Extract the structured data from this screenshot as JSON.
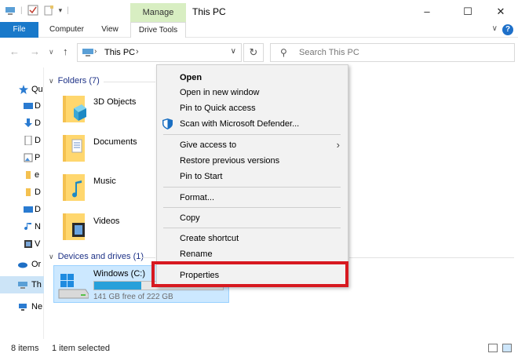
{
  "window": {
    "title": "This PC",
    "manage_tab": "Manage",
    "minimize": "–",
    "maximize": "☐",
    "close": "✕"
  },
  "ribbon": {
    "tabs": [
      "File",
      "Computer",
      "View",
      "Drive Tools"
    ],
    "help": "?"
  },
  "address": {
    "crumb": "This PC",
    "separator": "›",
    "search_placeholder": "Search This PC"
  },
  "navpane": {
    "items": [
      {
        "label": "Qu",
        "icon": "star-icon"
      },
      {
        "label": "D",
        "icon": "desktop-icon"
      },
      {
        "label": "D",
        "icon": "downloads-icon"
      },
      {
        "label": "D",
        "icon": "document-icon"
      },
      {
        "label": "P",
        "icon": "pictures-icon"
      },
      {
        "label": "e",
        "icon": "folder-icon"
      },
      {
        "label": "D",
        "icon": "folder-icon"
      },
      {
        "label": "D",
        "icon": "desktop-icon"
      },
      {
        "label": "N",
        "icon": "music-icon"
      },
      {
        "label": "V",
        "icon": "video-icon"
      },
      {
        "label": "Or",
        "icon": "onedrive-icon"
      },
      {
        "label": "Th",
        "icon": "pc-icon"
      },
      {
        "label": "Ne",
        "icon": "network-icon"
      }
    ]
  },
  "content": {
    "folders_header": "Folders (7)",
    "folders": [
      "3D Objects",
      "Documents",
      "Music",
      "Videos"
    ],
    "drives_header": "Devices and drives (1)",
    "drive": {
      "name": "Windows (C:)",
      "free_text": "141 GB free of 222 GB",
      "used_fraction": 0.365
    }
  },
  "context_menu": {
    "items": [
      {
        "label": "Open",
        "bold": true
      },
      {
        "label": "Open in new window"
      },
      {
        "label": "Pin to Quick access"
      },
      {
        "label": "Scan with Microsoft Defender...",
        "icon": "shield-icon"
      },
      {
        "label": "Give access to",
        "submenu": true
      },
      {
        "label": "Restore previous versions"
      },
      {
        "label": "Pin to Start"
      },
      {
        "label": "Format..."
      },
      {
        "label": "Copy"
      },
      {
        "label": "Create shortcut"
      },
      {
        "label": "Rename"
      },
      {
        "label": "Properties"
      }
    ],
    "submenu_arrow": "›",
    "highlight_color": "#d71920"
  },
  "status": {
    "items_count": "8 items",
    "selected": "1 item selected"
  },
  "colors": {
    "accent": "#1979ca",
    "manage": "#d8eec2",
    "selection": "#cce8ff",
    "drive_fill": "#26a0da"
  }
}
